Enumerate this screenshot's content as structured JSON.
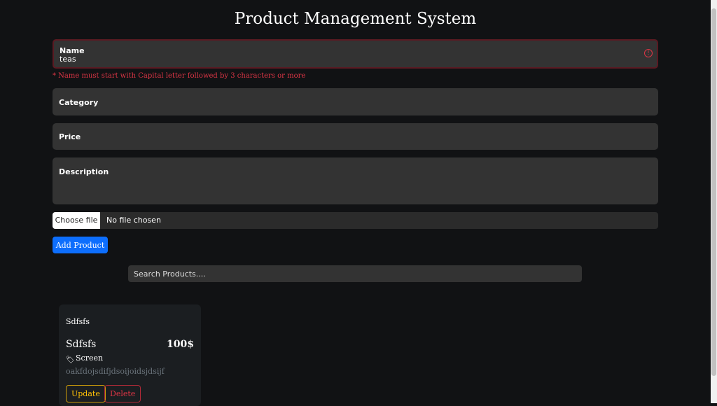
{
  "title": "Product Management System",
  "form": {
    "name_label": "Name",
    "name_value": "teas",
    "name_error": "* Name must start with Capital letter followed by 3 characters or more",
    "category_label": "Category",
    "price_label": "Price",
    "description_label": "Description",
    "choose_file": "Choose file",
    "no_file": "No file chosen",
    "add_button": "Add Product"
  },
  "search": {
    "placeholder": "Search Products...."
  },
  "products": [
    {
      "image_alt": "Sdfsfs",
      "name": "Sdfsfs",
      "price": "100$",
      "category": "Screen",
      "description": "oakfdojsdifjdsoijoidsjdsijf",
      "update": "Update",
      "delete": "Delete"
    }
  ]
}
